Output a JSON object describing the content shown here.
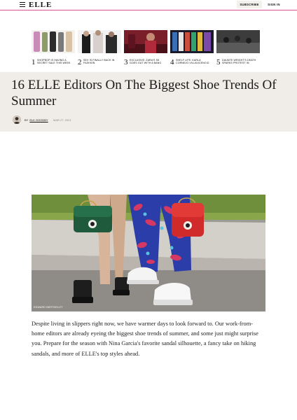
{
  "header": {
    "logo": "ELLE",
    "subscribe_label": "SUBSCRIBE",
    "sign_in_label": "SIGN IN"
  },
  "trending": [
    {
      "number": "1",
      "text": "SHOPBOP IS HAVING A SECRET SALE THIS WEEK"
    },
    {
      "number": "2",
      "text": "SEX IS FINALLY BACK IN FASHION"
    },
    {
      "number": "3",
      "text": "EXCLUSIVE: ZARA'S S5 GOES OUT WITH A BANG"
    },
    {
      "number": "4",
      "text": "SHELF LIFE: KARLA CORNEJO VILLAVICENCIO"
    },
    {
      "number": "5",
      "text": "DAUNTE WRIGHT'S DEATH SPARKS PROTEST IN MINNESOTA"
    }
  ],
  "article": {
    "title": "16 ELLE Editors On The Biggest Shoe Trends Of Summer",
    "by_prefix": "BY",
    "author": "ELK GOODBY",
    "date": "MAR 27, 2021",
    "image_credit": "EDWARD BERTHELOT",
    "intro": "Despite living in slippers right now, we have warmer days to look forward to. Our work-from-home editors are already eyeing the biggest shoe trends of summer, and some just might surprise you. Prepare for the season with Nina Garcia's favorite sandal silhouette, a fancy take on hiking sandals, and more of ELLE's top styles ahead."
  },
  "colors": {
    "accent": "#d94f9b",
    "band": "#f0ede8"
  }
}
